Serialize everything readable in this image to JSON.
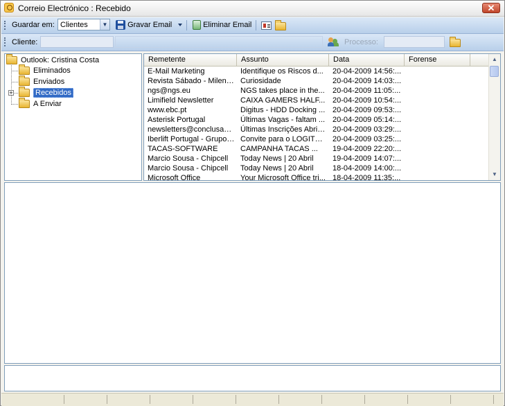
{
  "window": {
    "title": "Correio Electrónico : Recebido"
  },
  "toolbar": {
    "save_in_label": "Guardar em:",
    "save_in_value": "Clientes",
    "save_email_label": "Gravar Email",
    "delete_email_label": "Eliminar Email"
  },
  "filter_bar": {
    "client_label": "Cliente:",
    "process_label": "Processo:"
  },
  "folders": {
    "root": "Outlook: Cristina Costa",
    "items": [
      {
        "label": "Eliminados"
      },
      {
        "label": "Enviados"
      },
      {
        "label": "Recebidos",
        "selected": true,
        "expandable": true
      },
      {
        "label": "A Enviar"
      }
    ]
  },
  "email_list": {
    "columns": [
      "Remetente",
      "Assunto",
      "Data",
      "Forense"
    ],
    "rows": [
      {
        "sender": "E-Mail Marketing",
        "subject": "Identifique os Riscos d...",
        "date": "20-04-2009 14:56:...",
        "forense": ""
      },
      {
        "sender": "Revista Sábado - Milena...",
        "subject": "Curiosidade",
        "date": "20-04-2009 14:03:...",
        "forense": ""
      },
      {
        "sender": "ngs@ngs.eu",
        "subject": "NGS takes place in the...",
        "date": "20-04-2009 11:05:...",
        "forense": ""
      },
      {
        "sender": "Limifield Newsletter",
        "subject": "CAIXA GAMERS HALF...",
        "date": "20-04-2009 10:54:...",
        "forense": ""
      },
      {
        "sender": "www.ebc.pt",
        "subject": "Digitus - HDD Docking ...",
        "date": "20-04-2009 09:53:...",
        "forense": ""
      },
      {
        "sender": "Asterisk Portugal",
        "subject": "Últimas Vagas - faltam ...",
        "date": "20-04-2009 05:14:...",
        "forense": ""
      },
      {
        "sender": "newsletters@conclusao....",
        "subject": "Últimas Inscrições Abril ...",
        "date": "20-04-2009 03:29:...",
        "forense": ""
      },
      {
        "sender": "Iberlift Portugal - Grupo A...",
        "subject": "Convite para o LOGITR...",
        "date": "20-04-2009 03:25:...",
        "forense": ""
      },
      {
        "sender": "TACAS-SOFTWARE",
        "subject": "CAMPANHA  TACAS  ...",
        "date": "19-04-2009 22:20:...",
        "forense": ""
      },
      {
        "sender": "Marcio Sousa - Chipcell",
        "subject": "Today News | 20 Abril",
        "date": "19-04-2009 14:07:...",
        "forense": ""
      },
      {
        "sender": "Marcio Sousa - Chipcell",
        "subject": "Today News | 20 Abril",
        "date": "18-04-2009 14:00:...",
        "forense": ""
      },
      {
        "sender": "Microsoft Office",
        "subject": "Your Microsoft Office tri...",
        "date": "18-04-2009 11:35:...",
        "forense": ""
      }
    ]
  }
}
